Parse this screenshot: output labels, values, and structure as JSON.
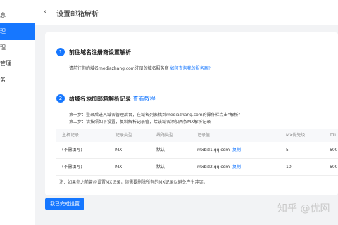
{
  "sidebar": {
    "items": [
      {
        "label": "息"
      },
      {
        "label": "理"
      },
      {
        "label": "理"
      },
      {
        "label": "管理"
      },
      {
        "label": "务"
      }
    ]
  },
  "header": {
    "back_icon": "chevron-left-icon",
    "title": "设置邮箱解析"
  },
  "step1": {
    "number": "1",
    "title": "前往域名注册商设置解析",
    "desc": "请前往你的域名mediazhang.com注册的域名服务商",
    "link": "如何查询我的服务商?"
  },
  "step2": {
    "number": "2",
    "title": "给域名添加邮箱解析记录",
    "link": "查看教程",
    "line1": "第一步：登录后进入域名管理后台，在域名列表找到mediazhang.com的操作栏点击\"解析\"",
    "line2": "第二步：请按照如下设置，复制解析记录值，给该域名添加两条MX解析记录"
  },
  "table": {
    "headers": [
      "主机记录",
      "记录类型",
      "线路类型",
      "记录值",
      "MX优先级",
      "TTL"
    ],
    "rows": [
      {
        "host": "(不需填写)",
        "type": "MX",
        "line": "默认",
        "value": "mxbiz1.qq.com",
        "copy": "复制",
        "priority": "5",
        "ttl": "600"
      },
      {
        "host": "(不需填写)",
        "type": "MX",
        "line": "默认",
        "value": "mxbiz2.qq.com",
        "copy": "复制",
        "priority": "10",
        "ttl": "600"
      }
    ]
  },
  "note": "注：如果你之前曾经设置MX记录，你需要删除所有的MX记录以避免产生冲突。",
  "done_button": "我已完成设置",
  "watermark": "知乎 @优网"
}
